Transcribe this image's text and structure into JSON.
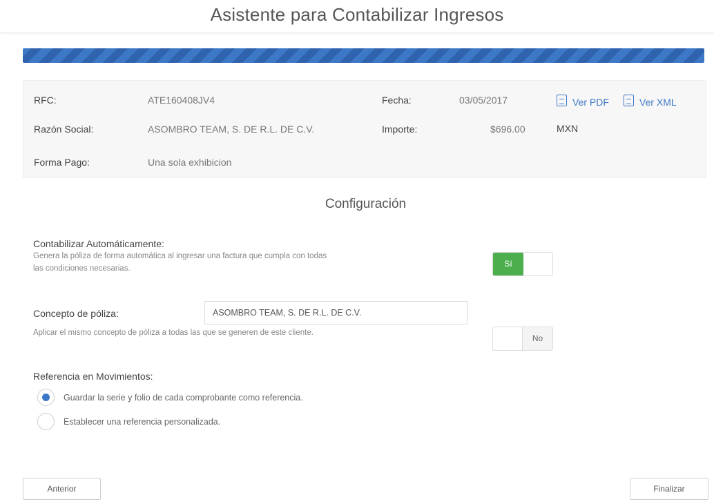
{
  "title": "Asistente para Contabilizar Ingresos",
  "progress_percent": 100,
  "invoice": {
    "rfc_label": "RFC:",
    "rfc_value": "ATE160408JV4",
    "razon_label": "Razón Social:",
    "razon_value": "ASOMBRO TEAM, S. DE R.L. DE C.V.",
    "forma_label": "Forma Pago:",
    "forma_value": "Una sola exhibicion",
    "fecha_label": "Fecha:",
    "fecha_value": "03/05/2017",
    "importe_label": "Importe:",
    "importe_value": "$696.00",
    "currency": "MXN",
    "ver_pdf": "Ver PDF",
    "ver_xml": "Ver XML"
  },
  "config": {
    "title": "Configuración",
    "auto": {
      "label": "Contabilizar Automáticamente:",
      "desc_line1": "Genera la póliza de forma automática al ingresar una factura que cumpla con todas",
      "desc_line2": "las condiciones necesarias.",
      "toggle_on": "Sí",
      "value": true
    },
    "concepto": {
      "label": "Concepto de póliza:",
      "value": "ASOMBRO TEAM, S. DE R.L. DE C.V.",
      "desc": "Aplicar el mismo concepto de póliza a todas las que se generen de este cliente.",
      "toggle_off": "No",
      "apply_all": false
    },
    "referencia": {
      "label": "Referencia en Movimientos:",
      "option1": "Guardar la serie y folio de cada comprobante como referencia.",
      "option2": "Establecer una referencia personalizada.",
      "selected": 1
    }
  },
  "buttons": {
    "prev": "Anterior",
    "finish": "Finalizar"
  },
  "colors": {
    "accent": "#3d78c6",
    "toggle_on": "#4cae4c"
  },
  "icons": [
    "pdf-file-icon",
    "xml-file-icon"
  ]
}
